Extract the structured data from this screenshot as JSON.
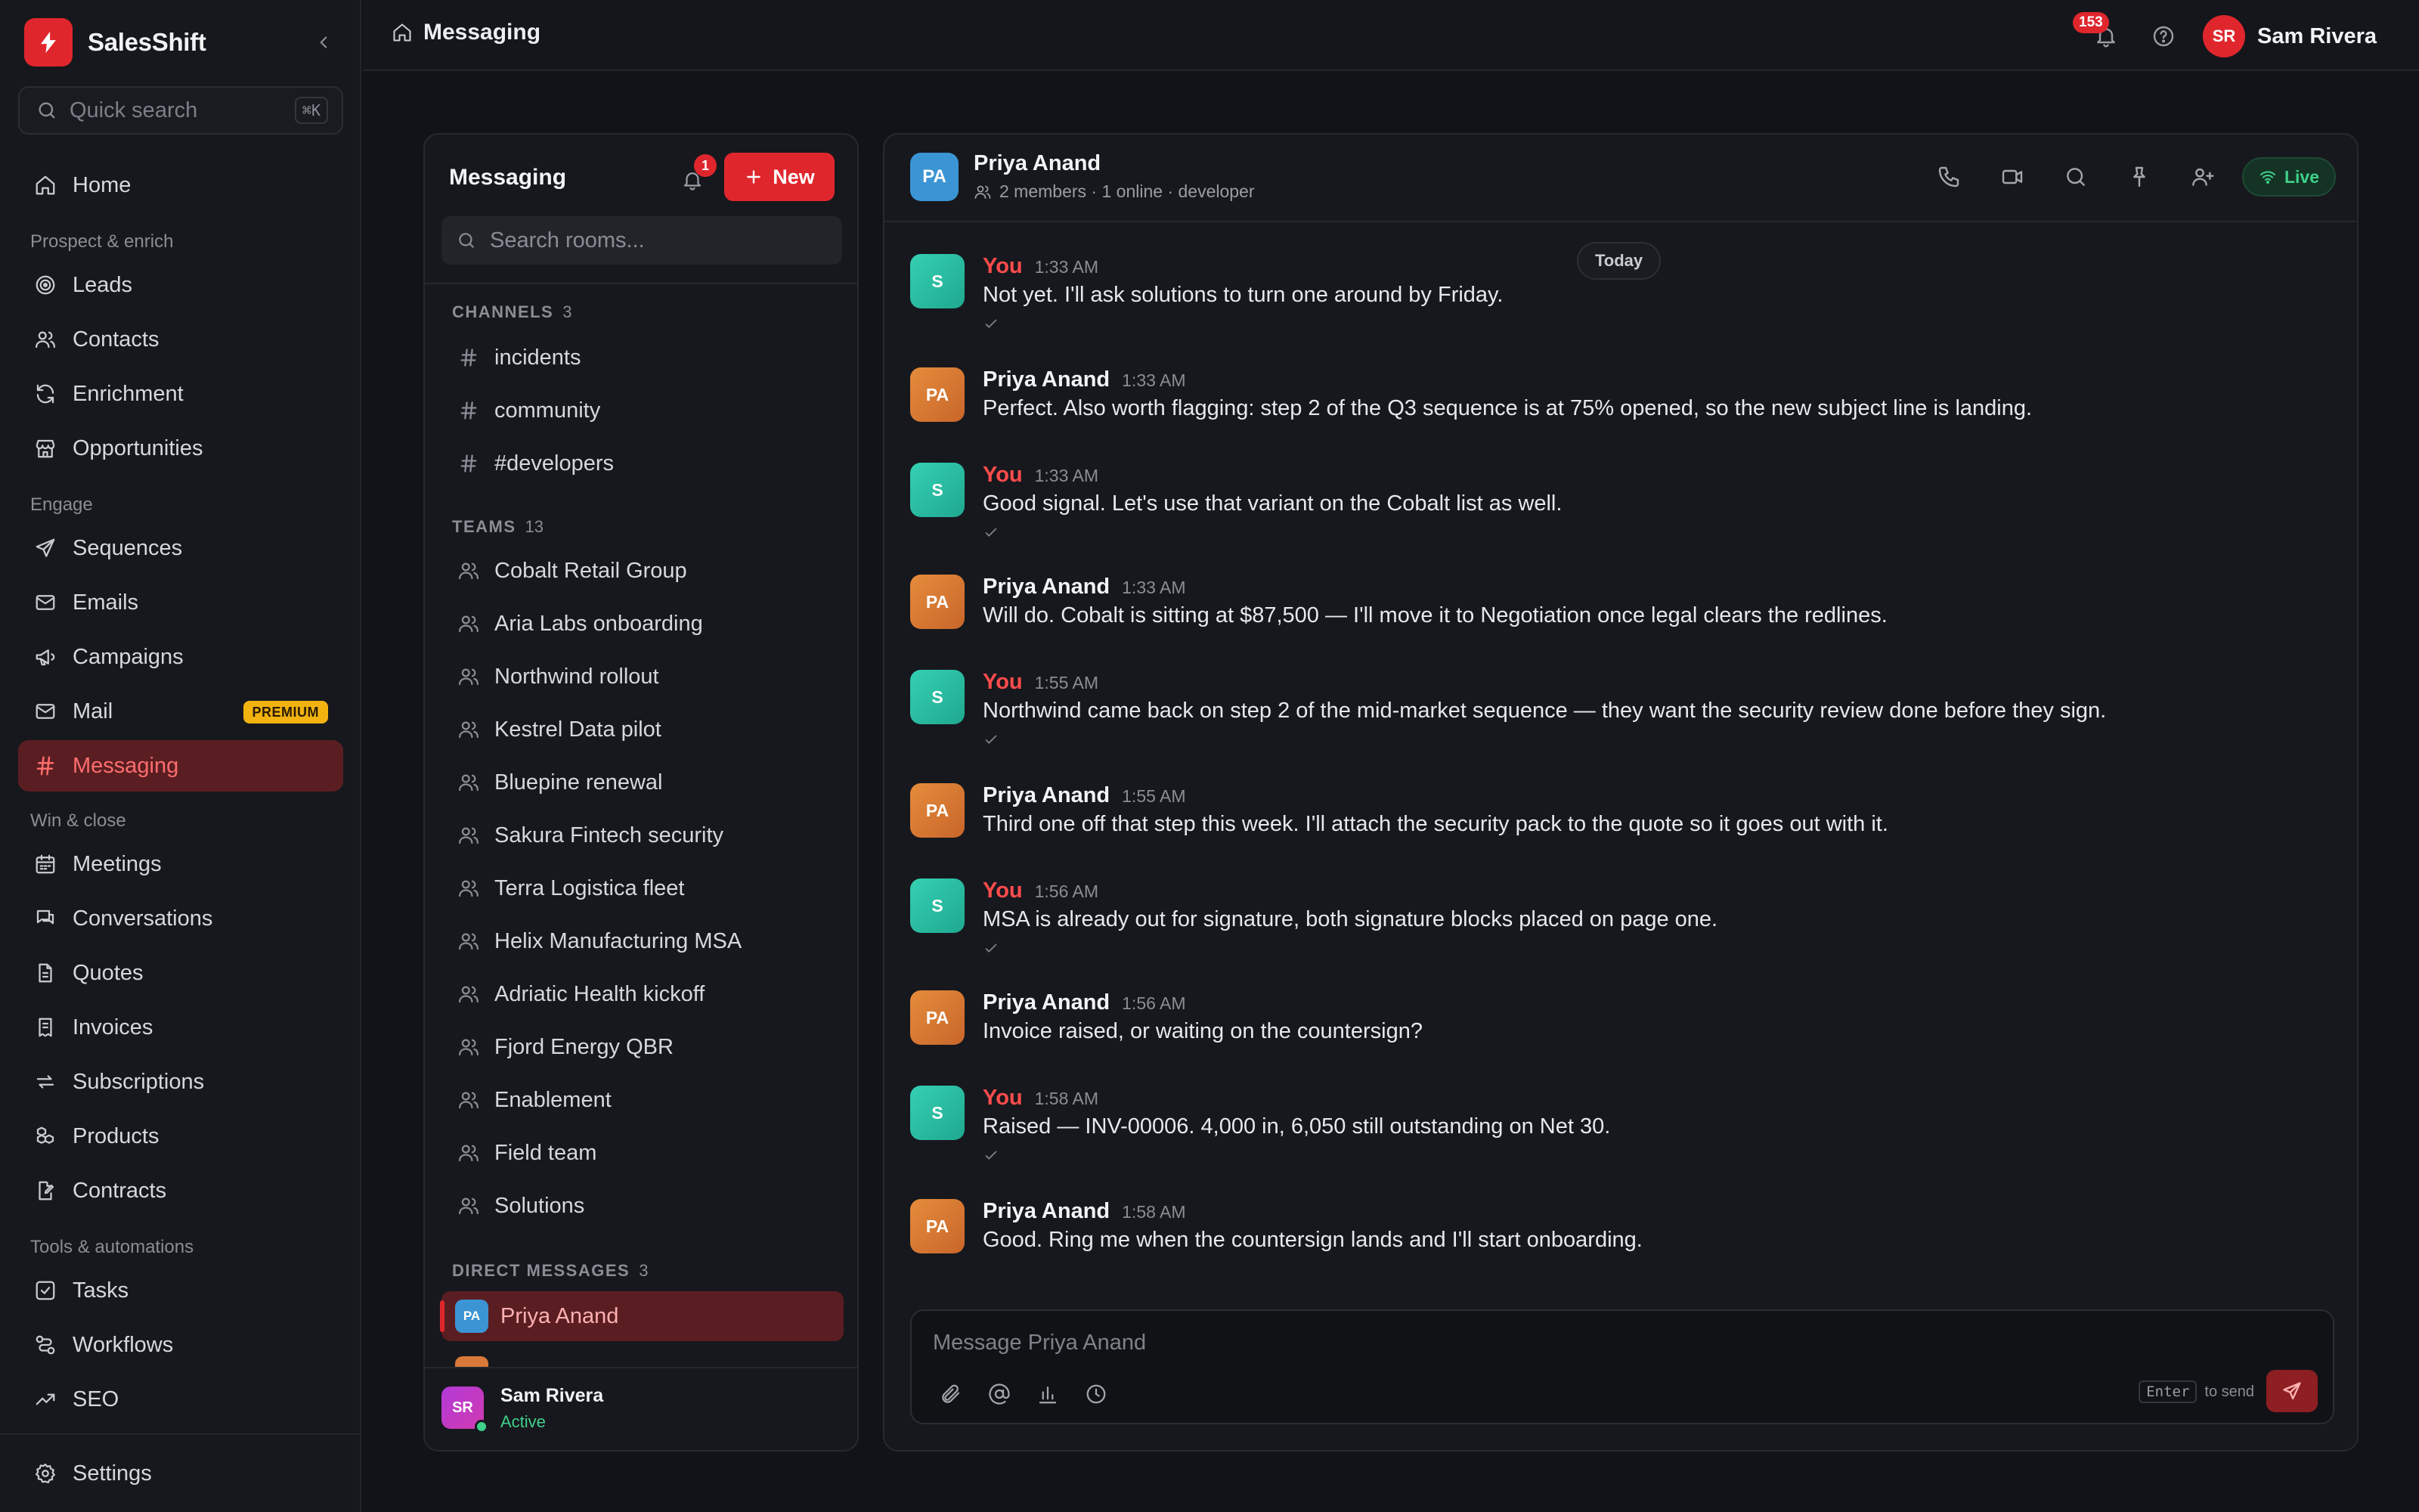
{
  "app": {
    "name": "SalesShift"
  },
  "sidebar": {
    "search": {
      "placeholder": "Quick search",
      "shortcut": "⌘K"
    },
    "sections": {
      "prospect": "Prospect & enrich",
      "engage": "Engage",
      "win": "Win & close",
      "tools": "Tools & automations"
    },
    "items": {
      "home": "Home",
      "leads": "Leads",
      "contacts": "Contacts",
      "enrichment": "Enrichment",
      "opportunities": "Opportunities",
      "sequences": "Sequences",
      "emails": "Emails",
      "campaigns": "Campaigns",
      "mail": "Mail",
      "messaging": "Messaging",
      "meetings": "Meetings",
      "conversations": "Conversations",
      "quotes": "Quotes",
      "invoices": "Invoices",
      "subscriptions": "Subscriptions",
      "products": "Products",
      "contracts": "Contracts",
      "tasks": "Tasks",
      "workflows": "Workflows",
      "seo": "SEO",
      "settings": "Settings"
    },
    "mail_badge": "PREMIUM",
    "active": "messaging"
  },
  "topbar": {
    "breadcrumb": "Messaging",
    "notifications_count": "153",
    "user": {
      "initials": "SR",
      "name": "Sam Rivera"
    }
  },
  "rooms": {
    "title": "Messaging",
    "bell_count": "1",
    "new_label": "New",
    "search_placeholder": "Search rooms...",
    "channels_label": "CHANNELS",
    "channels_count": "3",
    "channels": [
      "incidents",
      "community",
      "#developers"
    ],
    "teams_label": "TEAMS",
    "teams_count": "13",
    "teams": [
      "Cobalt Retail Group",
      "Aria Labs onboarding",
      "Northwind rollout",
      "Kestrel Data pilot",
      "Bluepine renewal",
      "Sakura Fintech security",
      "Terra Logistica fleet",
      "Helix Manufacturing MSA",
      "Adriatic Health kickoff",
      "Fjord Energy QBR",
      "Enablement",
      "Field team",
      "Solutions"
    ],
    "dm_label": "DIRECT MESSAGES",
    "dm_count": "3",
    "dms": [
      {
        "initials": "PA",
        "name": "Priya Anand",
        "active": true
      }
    ],
    "footer": {
      "initials": "SR",
      "name": "Sam Rivera",
      "status": "Active"
    }
  },
  "chat": {
    "avatar": "PA",
    "name": "Priya Anand",
    "subtitle": "2 members · 1 online · developer",
    "live_label": "Live",
    "date_divider": "Today",
    "messages": [
      {
        "initials": "S",
        "author": "You",
        "time": "1:33 AM",
        "text": "Not yet. I'll ask solutions to turn one around by Friday."
      },
      {
        "initials": "PA",
        "author": "Priya Anand",
        "time": "1:33 AM",
        "text": "Perfect. Also worth flagging: step 2 of the Q3 sequence is at 75% opened, so the new subject line is landing."
      },
      {
        "initials": "S",
        "author": "You",
        "time": "1:33 AM",
        "text": "Good signal. Let's use that variant on the Cobalt list as well."
      },
      {
        "initials": "PA",
        "author": "Priya Anand",
        "time": "1:33 AM",
        "text": "Will do. Cobalt is sitting at $87,500 — I'll move it to Negotiation once legal clears the redlines."
      },
      {
        "initials": "S",
        "author": "You",
        "time": "1:55 AM",
        "text": "Northwind came back on step 2 of the mid-market sequence — they want the security review done before they sign."
      },
      {
        "initials": "PA",
        "author": "Priya Anand",
        "time": "1:55 AM",
        "text": "Third one off that step this week. I'll attach the security pack to the quote so it goes out with it."
      },
      {
        "initials": "S",
        "author": "You",
        "time": "1:56 AM",
        "text": "MSA is already out for signature, both signature blocks placed on page one."
      },
      {
        "initials": "PA",
        "author": "Priya Anand",
        "time": "1:56 AM",
        "text": "Invoice raised, or waiting on the countersign?"
      },
      {
        "initials": "S",
        "author": "You",
        "time": "1:58 AM",
        "text": "Raised — INV-00006. 4,000 in, 6,050 still outstanding on Net 30."
      },
      {
        "initials": "PA",
        "author": "Priya Anand",
        "time": "1:58 AM",
        "text": "Good. Ring me when the countersign lands and I'll start onboarding."
      }
    ],
    "composer": {
      "placeholder": "Message Priya Anand",
      "hint_key": "Enter",
      "hint_text": "to send"
    }
  }
}
